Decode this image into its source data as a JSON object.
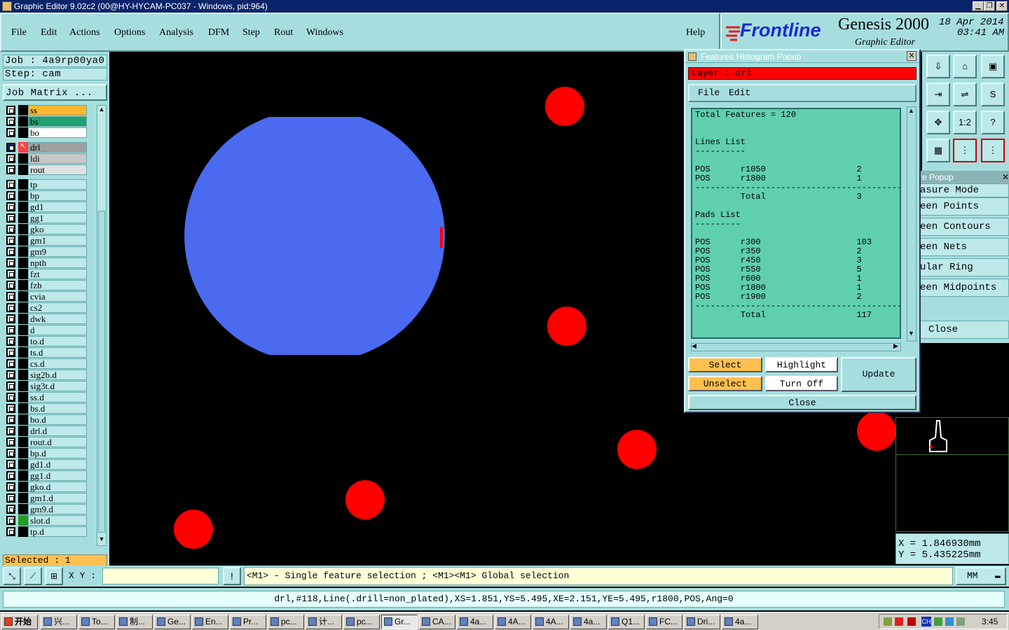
{
  "window": {
    "title": "Graphic Editor 9.02c2 (00@HY-HYCAM-PC037 - Windows, pid:964)",
    "buttons": [
      "▁",
      "❐",
      "✕"
    ]
  },
  "menu": {
    "items": [
      "File",
      "Edit",
      "Actions",
      "Options",
      "Analysis",
      "DFM",
      "Step",
      "Rout",
      "Windows"
    ],
    "help": "Help"
  },
  "logo": {
    "brand": "Frontline",
    "product": "Genesis 2000",
    "subtitle": "Graphic Editor",
    "date": "18 Apr 2014",
    "time": "03:41 AM"
  },
  "job": {
    "job_text": "Job : 4a9rp00ya0",
    "step_text": "Step: cam",
    "matrix_button": "Job Matrix ..."
  },
  "layers": [
    {
      "name": "ss",
      "color": "#ffb830",
      "mark": "⬋"
    },
    {
      "name": "bs",
      "color": "#20a070",
      "mark": ""
    },
    {
      "name": "bo",
      "color": "#ffffff",
      "mark": "⬋"
    },
    {
      "name": "drl",
      "color": "#a0a0a0",
      "mark": "⊞",
      "active": true
    },
    {
      "name": "ldi",
      "color": "#c8c8c8",
      "mark": ""
    },
    {
      "name": "rout",
      "color": "#e0e0e0",
      "mark": ""
    },
    {
      "name": "tp",
      "color": "#bde9e9",
      "mark": ""
    },
    {
      "name": "bp",
      "color": "#bde9e9",
      "mark": ""
    },
    {
      "name": "gd1",
      "color": "#bde9e9",
      "mark": "⬋"
    },
    {
      "name": "gg1",
      "color": "#bde9e9",
      "mark": ""
    },
    {
      "name": "gko",
      "color": "#bde9e9",
      "mark": ""
    },
    {
      "name": "gm1",
      "color": "#bde9e9",
      "mark": ""
    },
    {
      "name": "gm9",
      "color": "#bde9e9",
      "mark": "⬋"
    },
    {
      "name": "npth",
      "color": "#bde9e9",
      "mark": ""
    },
    {
      "name": "fzt",
      "color": "#bde9e9",
      "mark": ""
    },
    {
      "name": "fzb",
      "color": "#bde9e9",
      "mark": ""
    },
    {
      "name": "cvia",
      "color": "#bde9e9",
      "mark": ""
    },
    {
      "name": "cs2",
      "color": "#bde9e9",
      "mark": ""
    },
    {
      "name": "dwk",
      "color": "#bde9e9",
      "mark": ""
    },
    {
      "name": "d",
      "color": "#bde9e9",
      "mark": ""
    },
    {
      "name": "to.d",
      "color": "#bde9e9",
      "mark": "⬋"
    },
    {
      "name": "ts.d",
      "color": "#bde9e9",
      "mark": "⬋"
    },
    {
      "name": "cs.d",
      "color": "#bde9e9",
      "mark": "⬋"
    },
    {
      "name": "sig2b.d",
      "color": "#bde9e9",
      "mark": "⬋"
    },
    {
      "name": "sig3t.d",
      "color": "#bde9e9",
      "mark": "⬋"
    },
    {
      "name": "ss.d",
      "color": "#bde9e9",
      "mark": "⬋"
    },
    {
      "name": "bs.d",
      "color": "#bde9e9",
      "mark": ""
    },
    {
      "name": "bo.d",
      "color": "#bde9e9",
      "mark": "⬋"
    },
    {
      "name": "drl.d",
      "color": "#bde9e9",
      "mark": ""
    },
    {
      "name": "rout.d",
      "color": "#bde9e9",
      "mark": ""
    },
    {
      "name": "bp.d",
      "color": "#bde9e9",
      "mark": ""
    },
    {
      "name": "gd1.d",
      "color": "#bde9e9",
      "mark": "⬋"
    },
    {
      "name": "gg1.d",
      "color": "#bde9e9",
      "mark": ""
    },
    {
      "name": "gko.d",
      "color": "#bde9e9",
      "mark": ""
    },
    {
      "name": "gm1.d",
      "color": "#bde9e9",
      "mark": ""
    },
    {
      "name": "gm9.d",
      "color": "#bde9e9",
      "mark": "⬋"
    },
    {
      "name": "slot.d",
      "color": "#bde9e9",
      "mark": ""
    },
    {
      "name": "tp.d",
      "color": "#bde9e9",
      "mark": ""
    }
  ],
  "selected_text": "Selected : 1",
  "histogram": {
    "title": "Features Histogram Popup",
    "layer_text": "Layer :  drl",
    "menu": [
      "File",
      "Edit"
    ],
    "total_line": "Total Features = 120",
    "lines_header": "Lines List",
    "lines": [
      {
        "pol": "POS",
        "sym": "r1050",
        "count": "2"
      },
      {
        "pol": "POS",
        "sym": "r1800",
        "count": "1"
      }
    ],
    "lines_total_label": "Total",
    "lines_total": "3",
    "pads_header": "Pads List",
    "pads": [
      {
        "pol": "POS",
        "sym": "r300",
        "count": "103"
      },
      {
        "pol": "POS",
        "sym": "r350",
        "count": "2"
      },
      {
        "pol": "POS",
        "sym": "r450",
        "count": "3"
      },
      {
        "pol": "POS",
        "sym": "r550",
        "count": "5"
      },
      {
        "pol": "POS",
        "sym": "r600",
        "count": "1"
      },
      {
        "pol": "POS",
        "sym": "r1800",
        "count": "1"
      },
      {
        "pol": "POS",
        "sym": "r1900",
        "count": "2"
      }
    ],
    "pads_total_label": "Total",
    "pads_total": "117",
    "buttons": {
      "select": "Select",
      "highlight": "Highlight",
      "update": "Update",
      "unselect": "Unselect",
      "turn_off": "Turn Off",
      "close": "Close"
    }
  },
  "measure": {
    "title": "re Popup",
    "items": [
      "asure Mode",
      "een Points",
      "een Contours",
      "een Nets",
      "ular Ring",
      "een Midpoints"
    ],
    "close": "Close"
  },
  "coords": {
    "x": "X  =  1.846930mm",
    "y": "Y  =  5.435225mm"
  },
  "command": {
    "xy_label": "X Y :",
    "xy_value": "",
    "exclaim": "!",
    "hint": "<M1> - Single feature selection ; <M1><M1> Global selection",
    "units": "MM"
  },
  "status_line": "drl,#118,Line(.drill=non_plated),XS=1.851,YS=5.495,XE=2.151,YE=5.495,r1800,POS,Ang=0",
  "taskbar": {
    "start": "开始",
    "tasks": [
      "兴...",
      "To...",
      "制...",
      "Ge...",
      "En...",
      "Pr...",
      "pc...",
      "计...",
      "pc...",
      "Gr...",
      "CA...",
      "4a...",
      "4A...",
      "4A...",
      "4a...",
      "Q1...",
      "FC...",
      "Dri...",
      "4a..."
    ],
    "tray_lang": "CH",
    "clock": "3:45"
  },
  "colors": {
    "panel": "#a6dede",
    "field": "#bde9e9",
    "feature_red": "#ff0000",
    "blob_blue": "#4a6af0",
    "hist_bg": "#5fcfb0",
    "orange_btn": "#ffc050"
  }
}
